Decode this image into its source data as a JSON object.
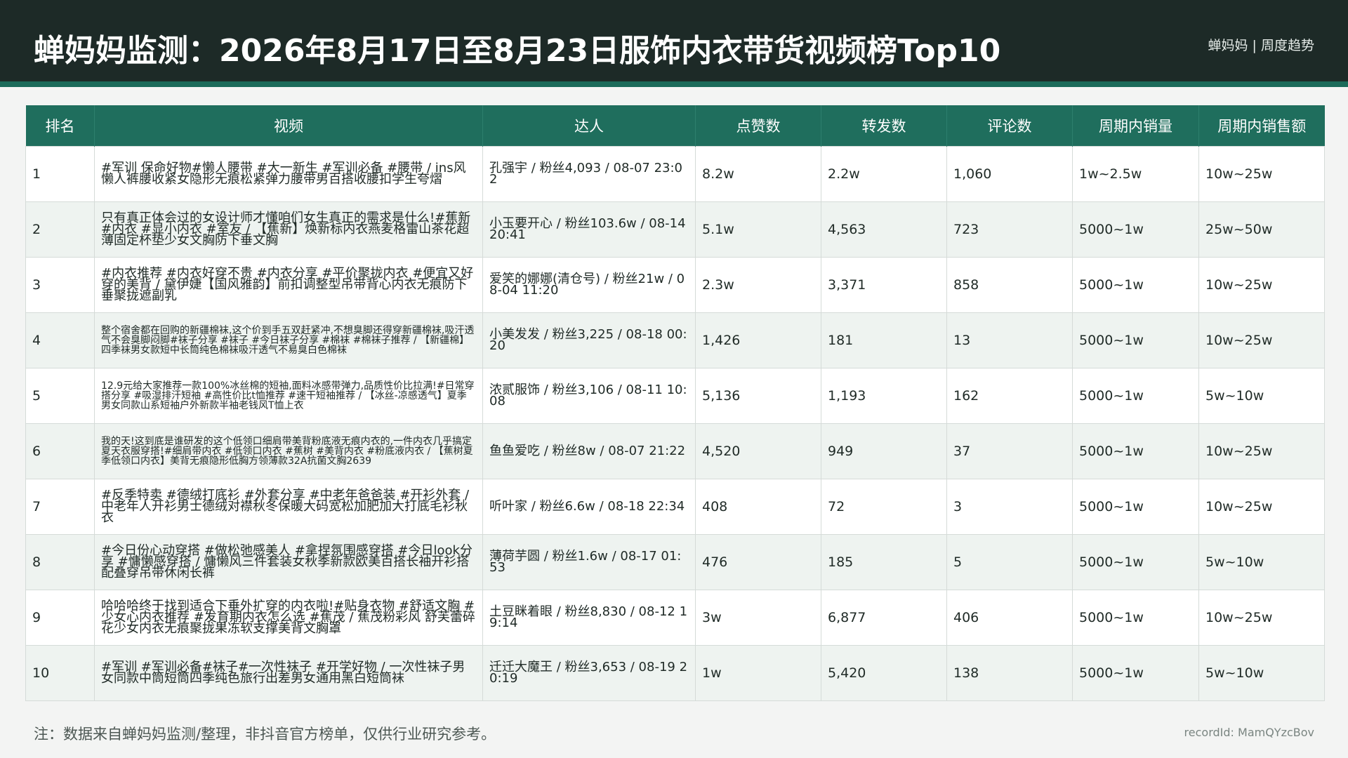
{
  "header": {
    "title": "蝉妈妈监测：2026年8月17日至8月23日服饰内衣带货视频榜Top10",
    "brand": "蝉妈妈 | 周度趋势"
  },
  "table": {
    "columns": [
      "排名",
      "视频",
      "达人",
      "点赞数",
      "转发数",
      "评论数",
      "周期内销量",
      "周期内销售额"
    ],
    "rows": [
      {
        "rank": "1",
        "video": "#军训 保命好物#懒人腰带 #大一新生 #军训必备 #腰带 / ins风懒人裤腰收紧女隐形无痕松紧弹力腰带男百搭收腰扣学生夸熠",
        "expert": "孔强宇 / 粉丝4,093 / 08-07 23:02",
        "likes": "8.2w",
        "shares": "2.2w",
        "comments": "1,060",
        "sales": "1w~2.5w",
        "revenue": "10w~25w"
      },
      {
        "rank": "2",
        "video": "只有真正体会过的女设计师才懂咱们女生真正的需求是什么!#蕉新 #内衣 #显小内衣 #室友 / 【蕉新】焕新标内衣燕麦格雷山茶花超薄固定杯垫少女文胸防下垂文胸",
        "expert": "小玉要开心 / 粉丝103.6w / 08-14 20:41",
        "likes": "5.1w",
        "shares": "4,563",
        "comments": "723",
        "sales": "5000~1w",
        "revenue": "25w~50w"
      },
      {
        "rank": "3",
        "video": "#内衣推荐 #内衣好穿不贵 #内衣分享 #平价聚拢内衣 #便宜又好穿的美背 / 黛伊婕【国风雅韵】前扣调整型吊带背心内衣无痕防下垂聚拢遮副乳",
        "expert": "爱笑的娜娜(清仓号) / 粉丝21w / 08-04 11:20",
        "likes": "2.3w",
        "shares": "3,371",
        "comments": "858",
        "sales": "5000~1w",
        "revenue": "10w~25w"
      },
      {
        "rank": "4",
        "video": "整个宿舍都在回购的新疆棉袜,这个价到手五双赶紧冲,不想臭脚还得穿新疆棉袜,吸汗透气不会臭脚闷脚#袜子分享 #袜子 #今日袜子分享 #棉袜 #棉袜子推荐 / 【新疆棉】四季袜男女款短中长筒纯色棉袜吸汗透气不易臭白色棉袜",
        "expert": "小美发发 / 粉丝3,225 / 08-18 00:20",
        "likes": "1,426",
        "shares": "181",
        "comments": "13",
        "sales": "5000~1w",
        "revenue": "10w~25w"
      },
      {
        "rank": "5",
        "video": "12.9元给大家推荐一款100%冰丝棉的短袖,面料冰感带弹力,品质性价比拉满!#日常穿搭分享 #吸湿排汗短袖 #高性价比t恤推荐 #速干短袖推荐 / 【冰丝-凉感透气】夏季男女同款山系短袖户外新款半袖老钱风T恤上衣",
        "expert": "浓贰服饰 / 粉丝3,106 / 08-11 10:08",
        "likes": "5,136",
        "shares": "1,193",
        "comments": "162",
        "sales": "5000~1w",
        "revenue": "5w~10w"
      },
      {
        "rank": "6",
        "video": "我的天!这到底是谁研发的这个低领口细肩带美背粉底液无痕内衣的,一件内衣几乎搞定夏天衣服穿搭!#细肩带内衣 #低领口内衣 #蕉树 #美背内衣 #粉底液内衣 / 【蕉树夏季低领口内衣】美背无痕隐形低胸方领薄款32A抗菌文胸2639",
        "expert": "鱼鱼爱吃 / 粉丝8w / 08-07 21:22",
        "likes": "4,520",
        "shares": "949",
        "comments": "37",
        "sales": "5000~1w",
        "revenue": "10w~25w"
      },
      {
        "rank": "7",
        "video": "#反季特卖 #德绒打底衫 #外套分享 #中老年爸爸装 #开衫外套 / 中老年人开衫男士德绒对襟秋冬保暖大码宽松加肥加大打底毛衫秋衣",
        "expert": "听叶家 / 粉丝6.6w / 08-18 22:34",
        "likes": "408",
        "shares": "72",
        "comments": "3",
        "sales": "5000~1w",
        "revenue": "10w~25w"
      },
      {
        "rank": "8",
        "video": "#今日份心动穿搭 #做松弛感美人 #拿捏氛围感穿搭 #今日look分享 #慵懒感穿搭 / 慵懒风三件套装女秋季新款欧美百搭长袖开衫搭配叠穿吊带休闲长裤",
        "expert": "薄荷芋圆 / 粉丝1.6w / 08-17 01:53",
        "likes": "476",
        "shares": "185",
        "comments": "5",
        "sales": "5000~1w",
        "revenue": "5w~10w"
      },
      {
        "rank": "9",
        "video": "哈哈哈终于找到适合下垂外扩穿的内衣啦!#贴身衣物 #舒适文胸 #少女心内衣推荐 #发育期内衣怎么选 #蕉茂 / 蕉茂粉彩风 舒芙蕾碎花少女内衣无痕聚拢果冻软支撑美背文胸罩",
        "expert": "土豆眯着眼 / 粉丝8,830 / 08-12 19:14",
        "likes": "3w",
        "shares": "6,877",
        "comments": "406",
        "sales": "5000~1w",
        "revenue": "10w~25w"
      },
      {
        "rank": "10",
        "video": "#军训 #军训必备#袜子#一次性袜子 #开学好物 / 一次性袜子男女同款中筒短筒四季纯色旅行出差男女通用黑白短筒袜",
        "expert": "迁迁大魔王 / 粉丝3,653 / 08-19 20:19",
        "likes": "1w",
        "shares": "5,420",
        "comments": "138",
        "sales": "5000~1w",
        "revenue": "5w~10w"
      }
    ]
  },
  "footer": {
    "note": "注：数据来自蝉妈妈监测/整理，非抖音官方榜单，仅供行业研究参考。",
    "record": "recordId: MamQYzcBov"
  }
}
